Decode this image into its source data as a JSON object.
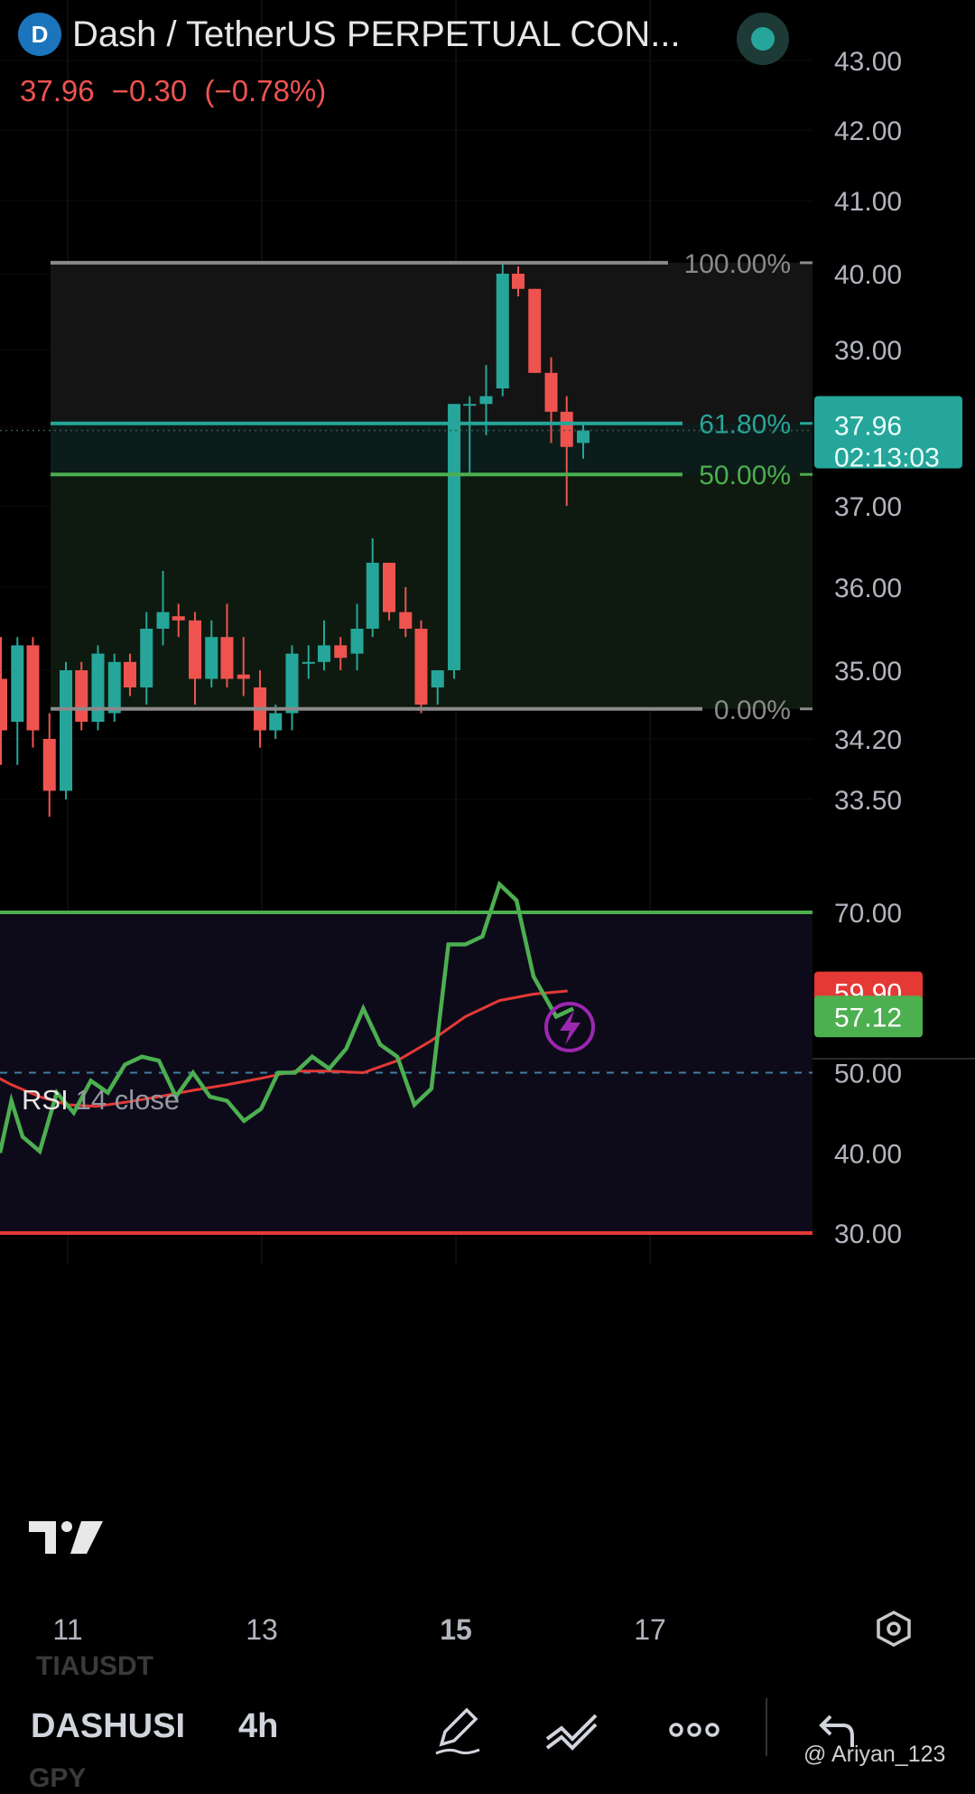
{
  "header": {
    "title": "Dash / TetherUS PERPETUAL CON...",
    "coin_icon": "dash-coin-icon",
    "status_icon": "market-open-dot-icon",
    "price": "37.96",
    "change": "−0.30",
    "change_pct": "(−0.78%)",
    "price_color": "#ef5350"
  },
  "colors": {
    "up": "#26a69a",
    "down": "#ef5350",
    "rsi": "#4caf50",
    "rsi_ma": "#e53935",
    "fib_teal": "#26a69a",
    "fib_green": "#4caf50"
  },
  "price_axis": {
    "labels": [
      "43.00",
      "42.00",
      "41.00",
      "40.00",
      "39.00",
      "37.00",
      "36.00",
      "35.00",
      "34.20",
      "33.50"
    ],
    "current_price": "37.96",
    "countdown": "02:13:03"
  },
  "fib": [
    {
      "level": 1.0,
      "label": "100.00%",
      "price": 40.15
    },
    {
      "level": 0.618,
      "label": "61.80%",
      "price": 38.05
    },
    {
      "level": 0.5,
      "label": "50.00%",
      "price": 37.4
    },
    {
      "level": 0.0,
      "label": "0.00%",
      "price": 34.55
    }
  ],
  "candles": [
    {
      "t": 10.0,
      "o": 34.9,
      "h": 35.4,
      "l": 33.9,
      "c": 34.3
    },
    {
      "t": 10.17,
      "o": 34.4,
      "h": 35.4,
      "l": 33.9,
      "c": 35.3
    },
    {
      "t": 10.33,
      "o": 35.3,
      "h": 35.4,
      "l": 34.1,
      "c": 34.3
    },
    {
      "t": 10.5,
      "o": 34.2,
      "h": 34.5,
      "l": 33.3,
      "c": 33.6
    },
    {
      "t": 10.67,
      "o": 33.6,
      "h": 35.1,
      "l": 33.5,
      "c": 35.0
    },
    {
      "t": 10.83,
      "o": 35.0,
      "h": 35.1,
      "l": 34.3,
      "c": 34.4
    },
    {
      "t": 11.0,
      "o": 34.4,
      "h": 35.3,
      "l": 34.3,
      "c": 35.2
    },
    {
      "t": 11.17,
      "o": 34.5,
      "h": 35.2,
      "l": 34.4,
      "c": 35.1
    },
    {
      "t": 11.33,
      "o": 35.1,
      "h": 35.2,
      "l": 34.7,
      "c": 34.8
    },
    {
      "t": 11.5,
      "o": 34.8,
      "h": 35.7,
      "l": 34.6,
      "c": 35.5
    },
    {
      "t": 11.67,
      "o": 35.5,
      "h": 36.2,
      "l": 35.3,
      "c": 35.7
    },
    {
      "t": 11.83,
      "o": 35.65,
      "h": 35.8,
      "l": 35.4,
      "c": 35.6
    },
    {
      "t": 12.0,
      "o": 35.6,
      "h": 35.7,
      "l": 34.6,
      "c": 34.9
    },
    {
      "t": 12.17,
      "o": 34.9,
      "h": 35.6,
      "l": 34.8,
      "c": 35.4
    },
    {
      "t": 12.33,
      "o": 35.4,
      "h": 35.8,
      "l": 34.8,
      "c": 34.9
    },
    {
      "t": 12.5,
      "o": 34.95,
      "h": 35.4,
      "l": 34.7,
      "c": 34.9
    },
    {
      "t": 12.67,
      "o": 34.8,
      "h": 35.0,
      "l": 34.1,
      "c": 34.3
    },
    {
      "t": 12.83,
      "o": 34.3,
      "h": 34.6,
      "l": 34.2,
      "c": 34.5
    },
    {
      "t": 13.0,
      "o": 34.5,
      "h": 35.3,
      "l": 34.3,
      "c": 35.2
    },
    {
      "t": 13.17,
      "o": 35.1,
      "h": 35.3,
      "l": 34.9,
      "c": 35.1
    },
    {
      "t": 13.33,
      "o": 35.1,
      "h": 35.6,
      "l": 35.0,
      "c": 35.3
    },
    {
      "t": 13.5,
      "o": 35.3,
      "h": 35.4,
      "l": 35.0,
      "c": 35.15
    },
    {
      "t": 13.67,
      "o": 35.2,
      "h": 35.8,
      "l": 35.0,
      "c": 35.5
    },
    {
      "t": 13.83,
      "o": 35.5,
      "h": 36.6,
      "l": 35.4,
      "c": 36.3
    },
    {
      "t": 14.0,
      "o": 36.3,
      "h": 36.3,
      "l": 35.6,
      "c": 35.7
    },
    {
      "t": 14.17,
      "o": 35.7,
      "h": 36.0,
      "l": 35.4,
      "c": 35.5
    },
    {
      "t": 14.33,
      "o": 35.5,
      "h": 35.6,
      "l": 34.5,
      "c": 34.6
    },
    {
      "t": 14.5,
      "o": 34.8,
      "h": 35.0,
      "l": 34.6,
      "c": 35.0
    },
    {
      "t": 14.67,
      "o": 35.0,
      "h": 38.3,
      "l": 34.9,
      "c": 38.3
    },
    {
      "t": 14.83,
      "o": 38.3,
      "h": 38.4,
      "l": 37.4,
      "c": 38.3
    },
    {
      "t": 15.0,
      "o": 38.3,
      "h": 38.8,
      "l": 37.9,
      "c": 38.4
    },
    {
      "t": 15.17,
      "o": 38.5,
      "h": 40.15,
      "l": 38.4,
      "c": 40.0
    },
    {
      "t": 15.33,
      "o": 40.0,
      "h": 40.1,
      "l": 39.7,
      "c": 39.8
    },
    {
      "t": 15.5,
      "o": 39.8,
      "h": 39.8,
      "l": 38.7,
      "c": 38.7
    },
    {
      "t": 15.67,
      "o": 38.7,
      "h": 38.9,
      "l": 37.8,
      "c": 38.2
    },
    {
      "t": 15.83,
      "o": 38.2,
      "h": 38.4,
      "l": 37.0,
      "c": 37.75
    },
    {
      "t": 16.0,
      "o": 37.8,
      "h": 38.05,
      "l": 37.6,
      "c": 37.96
    }
  ],
  "rsi": {
    "label": "RSI",
    "params": "14 close",
    "axis_labels": [
      "70.00",
      "50.00",
      "40.00",
      "30.00"
    ],
    "value": "57.12",
    "ma_value": "59.90",
    "line": [
      [
        10.0,
        40.0
      ],
      [
        10.1,
        46.5
      ],
      [
        10.2,
        42.0
      ],
      [
        10.35,
        40.2
      ],
      [
        10.5,
        47.5
      ],
      [
        10.65,
        45.0
      ],
      [
        10.8,
        49.0
      ],
      [
        10.95,
        47.5
      ],
      [
        11.1,
        51.0
      ],
      [
        11.25,
        52.0
      ],
      [
        11.4,
        51.5
      ],
      [
        11.55,
        47.0
      ],
      [
        11.7,
        50.0
      ],
      [
        11.85,
        47.0
      ],
      [
        12.0,
        46.5
      ],
      [
        12.15,
        44.0
      ],
      [
        12.3,
        45.5
      ],
      [
        12.45,
        50.0
      ],
      [
        12.6,
        50.0
      ],
      [
        12.75,
        52.0
      ],
      [
        12.9,
        50.5
      ],
      [
        13.05,
        53.0
      ],
      [
        13.2,
        58.0
      ],
      [
        13.35,
        53.5
      ],
      [
        13.5,
        52.0
      ],
      [
        13.65,
        46.0
      ],
      [
        13.8,
        48.0
      ],
      [
        13.95,
        66.0
      ],
      [
        14.1,
        66.0
      ],
      [
        14.25,
        67.0
      ],
      [
        14.4,
        73.5
      ],
      [
        14.55,
        71.5
      ],
      [
        14.7,
        62.0
      ],
      [
        14.9,
        57.0
      ],
      [
        15.05,
        58.0
      ]
    ],
    "ma": [
      [
        9.55,
        53.0
      ],
      [
        9.9,
        50.0
      ],
      [
        10.1,
        48.5
      ],
      [
        10.35,
        47.0
      ],
      [
        10.6,
        46.0
      ],
      [
        10.85,
        45.8
      ],
      [
        11.1,
        46.3
      ],
      [
        11.4,
        47.0
      ],
      [
        11.7,
        47.8
      ],
      [
        12.0,
        48.5
      ],
      [
        12.3,
        49.3
      ],
      [
        12.6,
        50.2
      ],
      [
        12.9,
        50.2
      ],
      [
        13.2,
        50.0
      ],
      [
        13.5,
        51.5
      ],
      [
        13.8,
        54.0
      ],
      [
        14.1,
        57.0
      ],
      [
        14.4,
        59.0
      ],
      [
        14.7,
        59.8
      ],
      [
        15.0,
        60.2
      ]
    ]
  },
  "time_axis": [
    "11",
    "13",
    "15",
    "17"
  ],
  "toolbar": {
    "symbol": "DASHUSI",
    "interval": "4h",
    "ghost_above": "TIAUSDT",
    "ghost_below": "GPY",
    "watermark": "@ Ariyan_123",
    "icons": [
      "pencil-icon",
      "trendline-icon",
      "more-icon",
      "undo-icon"
    ]
  },
  "settings_icon": "hexagon-settings-icon",
  "lightning_icon": "lightning-icon"
}
